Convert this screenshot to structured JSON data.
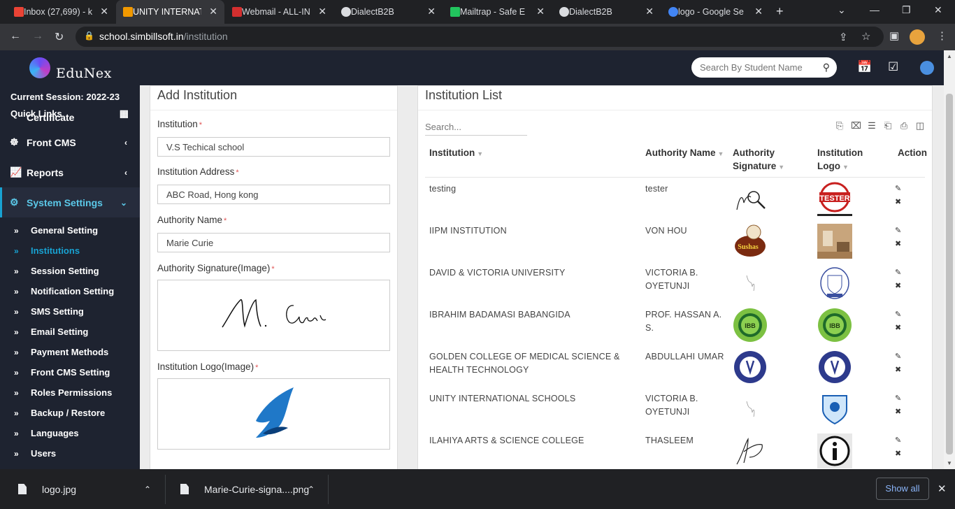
{
  "browser": {
    "tabs": [
      {
        "title": "Inbox (27,699) - k",
        "icon": "gmail-icon",
        "color": "#ea4335"
      },
      {
        "title": "UNITY INTERNATI",
        "icon": "edunex-icon",
        "color": "#f29900"
      },
      {
        "title": "Webmail - ALL-IN",
        "icon": "webmail-icon",
        "color": "#d32f2f"
      },
      {
        "title": "DialectB2B",
        "icon": "globe-icon",
        "color": "#dadce0"
      },
      {
        "title": "Mailtrap - Safe E",
        "icon": "mailtrap-icon",
        "color": "#22c55e"
      },
      {
        "title": "DialectB2B",
        "icon": "globe-icon",
        "color": "#dadce0"
      },
      {
        "title": "logo - Google Se",
        "icon": "google-icon",
        "color": "#4285f4"
      }
    ],
    "url_host": "school.simbillsoft.in",
    "url_path": "/institution"
  },
  "app": {
    "brand": "EduNex",
    "search_placeholder": "Search By Student Name"
  },
  "sidebar": {
    "session": "Current Session: 2022-23",
    "quick_links": "Quick Links",
    "cut_item": "Certificate",
    "menus": [
      {
        "label": "Front CMS",
        "icon": "cms-icon"
      },
      {
        "label": "Reports",
        "icon": "chart-icon"
      },
      {
        "label": "System Settings",
        "icon": "gears-icon"
      }
    ],
    "submenu": [
      "General Setting",
      "Institutions",
      "Session Setting",
      "Notification Setting",
      "SMS Setting",
      "Email Setting",
      "Payment Methods",
      "Front CMS Setting",
      "Roles Permissions",
      "Backup / Restore",
      "Languages",
      "Users"
    ]
  },
  "form": {
    "title": "Add Institution",
    "institution_label": "Institution",
    "institution_value": "V.S Techical school",
    "address_label": "Institution Address",
    "address_value": "ABC Road, Hong kong",
    "authority_label": "Authority Name",
    "authority_value": "Marie Curie",
    "signature_label": "Authority Signature(Image)",
    "signature_text": "M. Curie",
    "logo_label": "Institution Logo(Image)",
    "required_mark": "*"
  },
  "list": {
    "title": "Institution List",
    "search_placeholder": "Search...",
    "columns": {
      "institution": "Institution",
      "authority": "Authority Name",
      "signature_1": "Authority",
      "signature_2": "Signature",
      "logo_1": "Institution",
      "logo_2": "Logo",
      "action": "Action"
    },
    "rows": [
      {
        "institution": [
          "testing"
        ],
        "authority": [
          "tester"
        ],
        "sig_kind": "magnifier",
        "logo_kind": "tester"
      },
      {
        "institution": [
          "IIPM INSTITUTION"
        ],
        "authority": [
          "VON HOU"
        ],
        "sig_kind": "sushi",
        "logo_kind": "room"
      },
      {
        "institution": [
          "DAVID & VICTORIA UNIVERSITY"
        ],
        "authority": [
          "VICTORIA B.",
          "OYETUNJI"
        ],
        "sig_kind": "scribble",
        "logo_kind": "crest"
      },
      {
        "institution": [
          "IBRAHIM BADAMASI BABANGIDA"
        ],
        "authority": [
          "PROF. HASSAN A.",
          "S."
        ],
        "sig_kind": "green",
        "logo_kind": "green"
      },
      {
        "institution": [
          "GOLDEN COLLEGE OF MEDICAL SCIENCE &",
          "HEALTH TECHNOLOGY"
        ],
        "authority": [
          "ABDULLAHI UMAR"
        ],
        "sig_kind": "navy",
        "logo_kind": "navy"
      },
      {
        "institution": [
          "UNITY INTERNATIONAL SCHOOLS"
        ],
        "authority": [
          "VICTORIA B.",
          "OYETUNJI"
        ],
        "sig_kind": "scribble",
        "logo_kind": "shield"
      },
      {
        "institution": [
          "ILAHIYA ARTS & SCIENCE COLLEGE"
        ],
        "authority": [
          "THASLEEM"
        ],
        "sig_kind": "signature",
        "logo_kind": "info"
      }
    ]
  },
  "downloads": {
    "items": [
      "logo.jpg",
      "Marie-Curie-signa....png"
    ],
    "show_all": "Show all"
  }
}
